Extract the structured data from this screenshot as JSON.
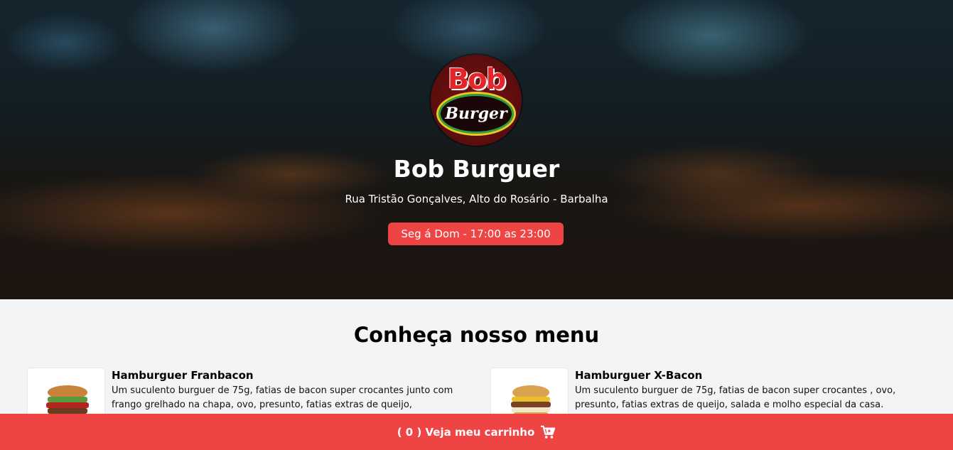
{
  "hero": {
    "logo": {
      "text_top": "Bob",
      "text_bottom": "Burger"
    },
    "title": "Bob Burguer",
    "address": "Rua Tristão Gonçalves, Alto do Rosário - Barbalha",
    "hours": "Seg á Dom - 17:00 as 23:00"
  },
  "menu": {
    "title": "Conheça nosso menu",
    "items": [
      {
        "name": "Hamburguer Franbacon",
        "description": "Um suculento burguer de 75g, fatias de bacon super crocantes junto com frango grelhado na chapa, ovo, presunto, fatias extras de queijo,"
      },
      {
        "name": "Hamburguer X-Bacon",
        "description": "Um suculento burguer de 75g, fatias de bacon super crocantes , ovo, presunto, fatias extras de queijo, salada e molho especial da casa."
      }
    ]
  },
  "cart": {
    "prefix": "( ",
    "count": "0",
    "suffix": " ) Veja meu carrinho",
    "icon": "shopping-cart-icon"
  },
  "colors": {
    "accent": "#ef4444",
    "background": "#f3f4f6"
  }
}
